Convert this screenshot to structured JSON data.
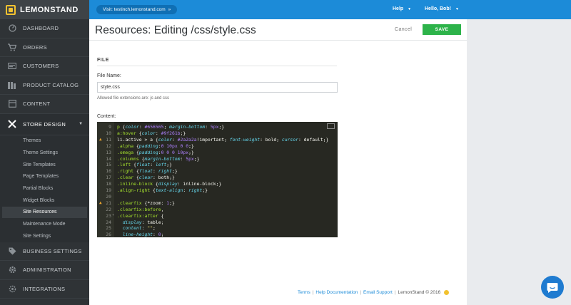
{
  "brand": {
    "name": "LEMONSTAND"
  },
  "topbar": {
    "visit_label": "Visit: testinch.lemonstand.com",
    "visit_arrow": "»",
    "help_label": "Help",
    "user_label": "Hello, Bob!"
  },
  "sidebar": {
    "items": [
      {
        "label": "DASHBOARD",
        "icon": "dashboard-icon"
      },
      {
        "label": "ORDERS",
        "icon": "cart-icon"
      },
      {
        "label": "CUSTOMERS",
        "icon": "customers-icon"
      },
      {
        "label": "PRODUCT CATALOG",
        "icon": "catalog-icon"
      },
      {
        "label": "CONTENT",
        "icon": "content-icon"
      },
      {
        "label": "STORE DESIGN",
        "icon": "tools-icon"
      }
    ],
    "sub_items": [
      "Themes",
      "Theme Settings",
      "Site Templates",
      "Page Templates",
      "Partial Blocks",
      "Widget Blocks",
      "Site Resources",
      "Maintenance Mode",
      "Site Settings"
    ],
    "active_sub": "Site Resources",
    "bottom_items": [
      {
        "label": "BUSINESS SETTINGS",
        "icon": "tag-icon"
      },
      {
        "label": "ADMINISTRATION",
        "icon": "gear-icon"
      },
      {
        "label": "INTEGRATIONS",
        "icon": "integrations-icon"
      }
    ]
  },
  "page": {
    "title": "Resources: Editing /css/style.css",
    "cancel_label": "Cancel",
    "save_label": "SAVE",
    "section_title": "FILE",
    "file_name_label": "File Name:",
    "file_name_value": "style.css",
    "file_help": "Allowed file extensions are: js and css",
    "content_label": "Content:"
  },
  "editor": {
    "lines": [
      {
        "n": "9",
        "warn": false,
        "fold": false,
        "html": "<span class=\"c-sel\">p</span> {<span class=\"c-prop\">color</span>: <span class=\"c-val\">#656565</span>; <span class=\"c-prop\">margin-bottom</span>: <span class=\"c-val\">5px</span>;}"
      },
      {
        "n": "10",
        "warn": false,
        "fold": false,
        "html": "<span class=\"c-sel\">a:hover</span> {<span class=\"c-prop\">color</span>: <span class=\"c-val\">#9f261b</span>;}"
      },
      {
        "n": "11",
        "warn": true,
        "fold": false,
        "html": "li.active &gt; a {<span class=\"c-prop\">color</span>: <span class=\"c-val\">#2a2a2a</span>!important; <span class=\"c-prop\">font-weight</span>: bold; <span class=\"c-prop\">cursor</span>: default;}"
      },
      {
        "n": "12",
        "warn": false,
        "fold": false,
        "html": "<span class=\"c-sel\">.alpha</span> {<span class=\"c-prop\">padding</span>:<span class=\"c-val\">0 10px 0 0</span>;}"
      },
      {
        "n": "13",
        "warn": false,
        "fold": false,
        "html": "<span class=\"c-sel\">.omega</span> {<span class=\"c-prop\">padding</span>:<span class=\"c-val\">0 0 0 10px</span>;}"
      },
      {
        "n": "14",
        "warn": false,
        "fold": false,
        "html": "<span class=\"c-sel\">.columns</span> {<span class=\"c-prop\">margin-bottom</span>: <span class=\"c-val\">5px</span>;}"
      },
      {
        "n": "15",
        "warn": false,
        "fold": false,
        "html": "<span class=\"c-sel\">.left</span> {<span class=\"c-prop\">float</span>: <span class=\"c-prop\">left</span>;}"
      },
      {
        "n": "16",
        "warn": false,
        "fold": false,
        "html": "<span class=\"c-sel\">.right</span> {<span class=\"c-prop\">float</span>: <span class=\"c-prop\">right</span>;}"
      },
      {
        "n": "17",
        "warn": false,
        "fold": false,
        "html": "<span class=\"c-sel\">.clear</span> {<span class=\"c-prop\">clear</span>: both;}"
      },
      {
        "n": "18",
        "warn": false,
        "fold": false,
        "html": "<span class=\"c-sel\">.inline-block</span> {<span class=\"c-prop\">display</span>: inline-block;}"
      },
      {
        "n": "19",
        "warn": false,
        "fold": false,
        "html": "<span class=\"c-sel\">.align-right</span> {<span class=\"c-prop\">text-align</span>: <span class=\"c-prop\">right</span>;}"
      },
      {
        "n": "20",
        "warn": false,
        "fold": false,
        "html": ""
      },
      {
        "n": "21",
        "warn": true,
        "fold": false,
        "html": "<span class=\"c-sel\">.clearfix</span> {*zoom: <span class=\"c-val\">1</span>;}"
      },
      {
        "n": "22",
        "warn": false,
        "fold": false,
        "html": "<span class=\"c-sel\">.clearfix:before</span>,"
      },
      {
        "n": "23",
        "warn": false,
        "fold": true,
        "html": "<span class=\"c-sel\">.clearfix:after</span> {"
      },
      {
        "n": "24",
        "warn": false,
        "fold": false,
        "html": "  <span class=\"c-prop\">display</span>: table;"
      },
      {
        "n": "25",
        "warn": false,
        "fold": false,
        "html": "  <span class=\"c-prop\">content</span>: <span class=\"c-str\">\"\"</span>;"
      },
      {
        "n": "26",
        "warn": false,
        "fold": false,
        "html": "  <span class=\"c-prop\">line-height</span>: <span class=\"c-val\">0</span>;"
      }
    ]
  },
  "footer": {
    "terms": "Terms",
    "help_docs": "Help Documentation",
    "email_support": "Email Support",
    "copyright": "LemonStand © 2016"
  },
  "colors": {
    "accent": "#1c8bd8",
    "save": "#2db34a",
    "sidebar_bg": "#2f3336",
    "brand_yellow": "#f2c230"
  }
}
